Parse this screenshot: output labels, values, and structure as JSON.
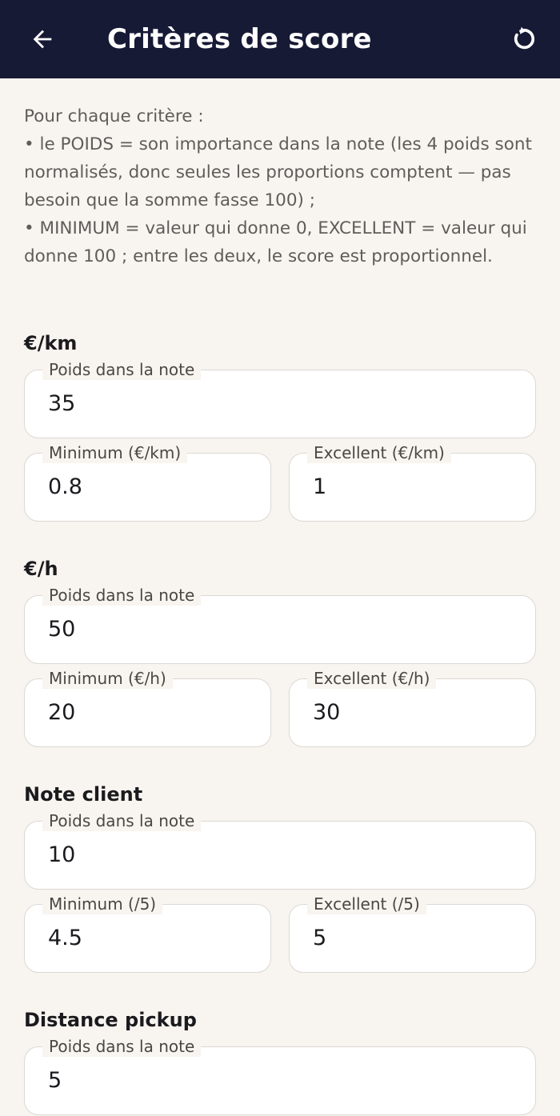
{
  "appbar": {
    "title": "Critères de score",
    "back_icon": "arrow-back-icon",
    "reset_icon": "refresh-icon",
    "background": "#161a35"
  },
  "intro": {
    "line1": "Pour chaque critère :",
    "line2": "• le POIDS = son importance dans la note (les 4 poids sont normalisés, donc seules les proportions comptent — pas besoin que la somme fasse 100) ;",
    "line3": "• MINIMUM = valeur qui donne 0, EXCELLENT = valeur qui donne 100 ; entre les deux, le score est proportionnel."
  },
  "criteria": [
    {
      "title": "€/km",
      "weight_label": "Poids dans la note",
      "weight_value": "35",
      "min_label": "Minimum (€/km)",
      "min_value": "0.8",
      "max_label": "Excellent (€/km)",
      "max_value": "1"
    },
    {
      "title": "€/h",
      "weight_label": "Poids dans la note",
      "weight_value": "50",
      "min_label": "Minimum (€/h)",
      "min_value": "20",
      "max_label": "Excellent (€/h)",
      "max_value": "30"
    },
    {
      "title": "Note client",
      "weight_label": "Poids dans la note",
      "weight_value": "10",
      "min_label": "Minimum (/5)",
      "min_value": "4.5",
      "max_label": "Excellent (/5)",
      "max_value": "5"
    },
    {
      "title": "Distance pickup",
      "weight_label": "Poids dans la note",
      "weight_value": "5"
    }
  ]
}
